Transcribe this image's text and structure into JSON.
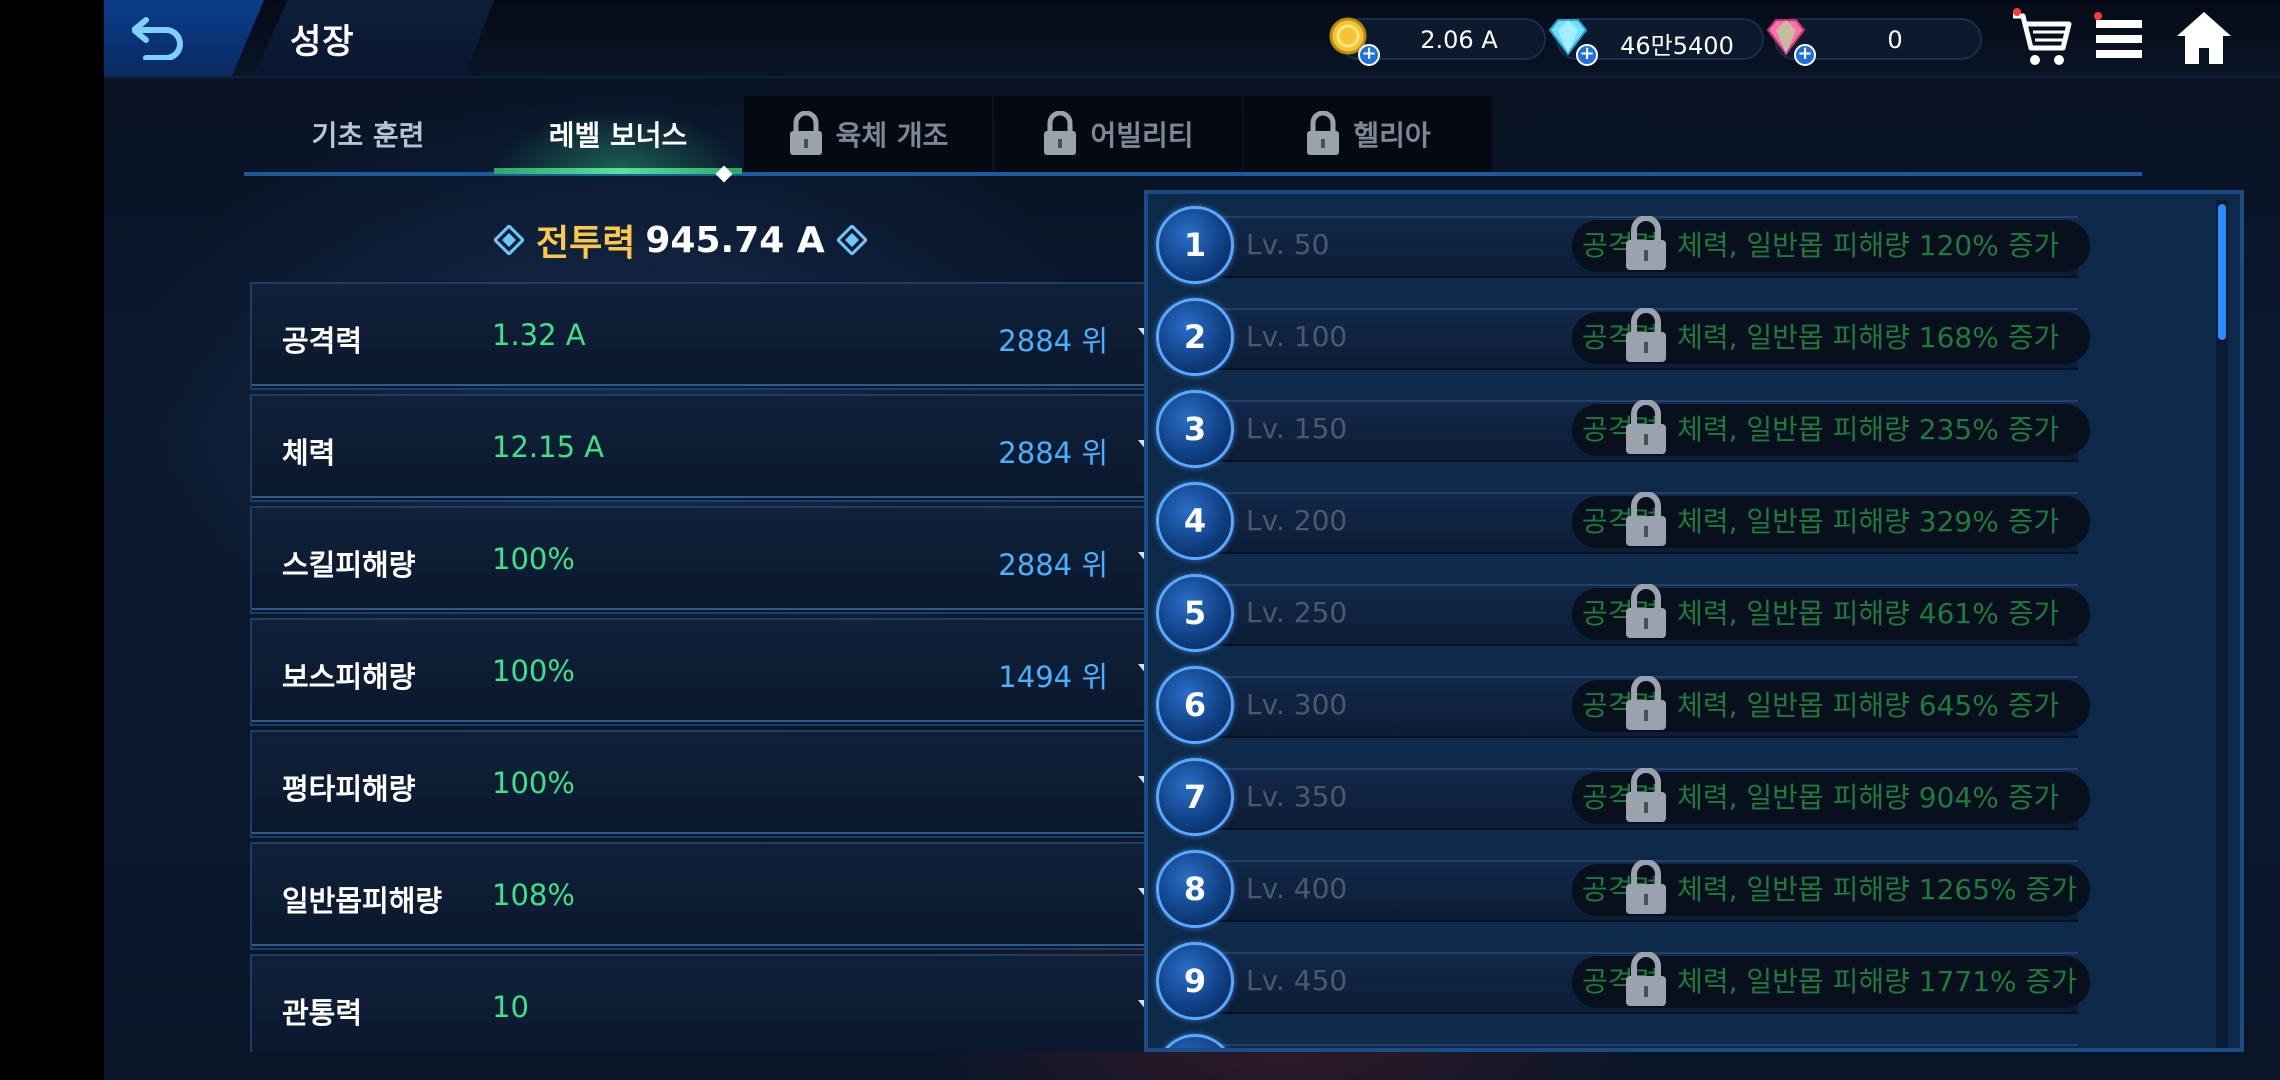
{
  "header": {
    "title": "성장",
    "currencies": [
      {
        "name": "gold",
        "value": "2.06 A",
        "color": "#f4c430"
      },
      {
        "name": "diamond",
        "value": "46만5400",
        "color": "#6fe0ff"
      },
      {
        "name": "gem",
        "value": "0",
        "color": "#ff6fa8"
      }
    ]
  },
  "tabs": [
    {
      "label": "기초 훈련",
      "state": "normal"
    },
    {
      "label": "레벨 보너스",
      "state": "active"
    },
    {
      "label": "육체 개조",
      "state": "locked"
    },
    {
      "label": "어빌리티",
      "state": "locked"
    },
    {
      "label": "헬리아",
      "state": "locked"
    }
  ],
  "combat_power": {
    "label": "전투력",
    "value": "945.74 A"
  },
  "stats": [
    {
      "name": "공격력",
      "value": "1.32 A",
      "rank": "2884 위"
    },
    {
      "name": "체력",
      "value": "12.15 A",
      "rank": "2884 위"
    },
    {
      "name": "스킬피해량",
      "value": "100%",
      "rank": "2884 위"
    },
    {
      "name": "보스피해량",
      "value": "100%",
      "rank": "1494 위"
    },
    {
      "name": "평타피해량",
      "value": "100%",
      "rank": ""
    },
    {
      "name": "일반몹피해량",
      "value": "108%",
      "rank": ""
    },
    {
      "name": "관통력",
      "value": "10",
      "rank": ""
    }
  ],
  "bonuses": [
    {
      "num": "1",
      "level": "Lv. 50",
      "desc": "공격력, 체력, 일반몹 피해량 120% 증가"
    },
    {
      "num": "2",
      "level": "Lv. 100",
      "desc": "공격력, 체력, 일반몹 피해량 168% 증가"
    },
    {
      "num": "3",
      "level": "Lv. 150",
      "desc": "공격력, 체력, 일반몹 피해량 235% 증가"
    },
    {
      "num": "4",
      "level": "Lv. 200",
      "desc": "공격력, 체력, 일반몹 피해량 329% 증가"
    },
    {
      "num": "5",
      "level": "Lv. 250",
      "desc": "공격력, 체력, 일반몹 피해량 461% 증가"
    },
    {
      "num": "6",
      "level": "Lv. 300",
      "desc": "공격력, 체력, 일반몹 피해량 645% 증가"
    },
    {
      "num": "7",
      "level": "Lv. 350",
      "desc": "공격력, 체력, 일반몹 피해량 904% 증가"
    },
    {
      "num": "8",
      "level": "Lv. 400",
      "desc": "공격력, 체력, 일반몹 피해량 1265% 증가"
    },
    {
      "num": "9",
      "level": "Lv. 450",
      "desc": "공격력, 체력, 일반몹 피해량 1771% 증가"
    }
  ],
  "icons": {
    "back": "back-arrow-icon",
    "cart": "cart-icon",
    "menu": "menu-icon",
    "home": "home-icon",
    "lock": "lock-icon",
    "expand": "chevron-down-icon",
    "diamond_marker": "diamond-marker-icon"
  }
}
